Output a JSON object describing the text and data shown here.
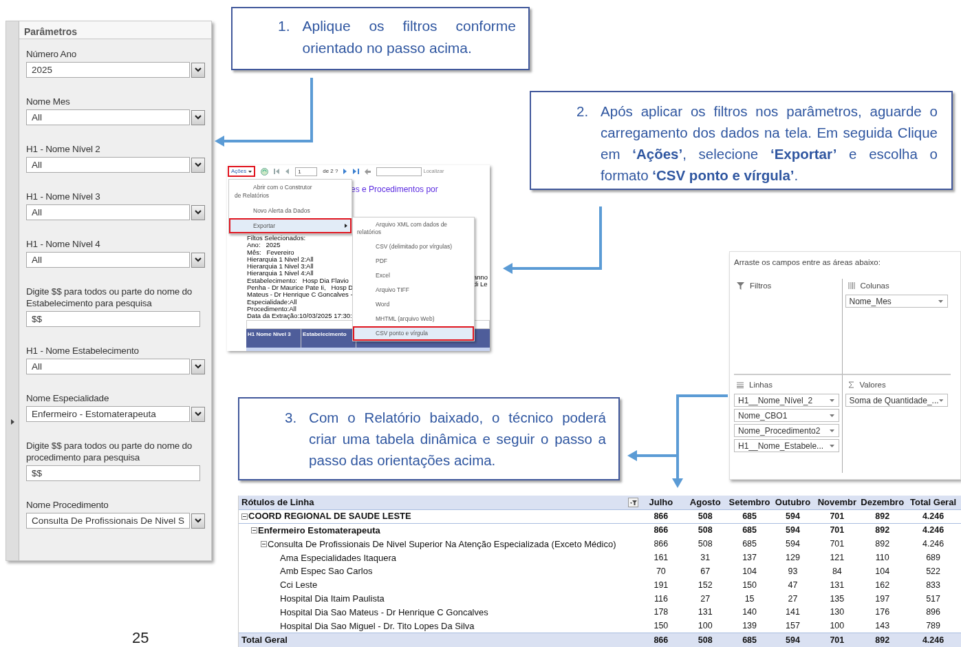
{
  "parameters_panel": {
    "title": "Parâmetros",
    "fields": [
      {
        "kind": "select",
        "label": "Número Ano",
        "value": "2025"
      },
      {
        "kind": "select",
        "label": "Nome Mes",
        "value": "All"
      },
      {
        "kind": "select",
        "label": "H1 - Nome Nível 2",
        "value": "All"
      },
      {
        "kind": "select",
        "label": "H1 - Nome Nível 3",
        "value": "All"
      },
      {
        "kind": "select",
        "label": "H1 - Nome Nível 4",
        "value": "All"
      },
      {
        "kind": "text",
        "label": "Digite $$ para todos ou parte do nome do Estabelecimento para pesquisa",
        "value": "$$"
      },
      {
        "kind": "select",
        "label": "H1 - Nome Estabelecimento",
        "value": "All"
      },
      {
        "kind": "select",
        "label": "Nome Especialidade",
        "value": "Enfermeiro - Estomaterapeuta"
      },
      {
        "kind": "text",
        "label": "Digite $$ para todos ou parte do nome do procedimento para pesquisa",
        "value": "$$"
      },
      {
        "kind": "select",
        "label": "Nome Procedimento",
        "value": "Consulta De Profissionais De Nivel S"
      }
    ]
  },
  "callouts": [
    {
      "number": "1.",
      "text": "Aplique os filtros conforme orientado no passo acima."
    },
    {
      "number": "2.",
      "text": "Após aplicar os filtros nos parâmetros, aguarde o carregamento dos dados na tela. Em seguida Clique em **‘Ações’**, selecione **‘Exportar’** e escolha o formato **‘CSV ponto e vírgula’**."
    },
    {
      "number": "3.",
      "text": "Com o Relatório baixado, o técnico poderá criar uma tabela dinâmica e seguir o passo a passo das orientações acima."
    }
  ],
  "report_viewer": {
    "actions": {
      "label": "Ações",
      "highlighted": true
    },
    "page": "1",
    "page_count": "de 2 ?",
    "find_label": "Localizar",
    "title_fragment": "es e Procedimentos por",
    "menu": [
      {
        "kind": "item",
        "label": "Abrir com o Construtor de Relatórios",
        "highlighted": false
      },
      {
        "kind": "item",
        "label": "Novo Alerta da Dados",
        "highlighted": false
      },
      {
        "kind": "submenu",
        "label": "Exportar",
        "highlighted": true
      }
    ],
    "export_menu": [
      {
        "label": "Arquivo XML com dados de relatórios",
        "highlighted": false
      },
      {
        "label": "CSV (delimitado por vírgulas)",
        "highlighted": false
      },
      {
        "label": "PDF",
        "highlighted": false
      },
      {
        "label": "Excel",
        "highlighted": false
      },
      {
        "label": "Arquivo TIFF",
        "highlighted": false
      },
      {
        "label": "Word",
        "highlighted": false
      },
      {
        "label": "MHTML (arquivo Web)",
        "highlighted": false
      },
      {
        "label": "CSV ponto e vírgula",
        "highlighted": true
      }
    ],
    "report_lines": [
      "Filtos Selecionados:",
      "Ano:   2025",
      "Mês:   Fevereiro",
      "Hierarquia 1 Nivel 2:All",
      "Hierarquia 1 Nivel 3:All",
      "Hierarquia 1 Nivel 4:All",
      "Estabelecimento:   Hosp Dia Flavio",
      "Penha - Dr Maurice Pate Ii,   Hosp D",
      "Mateus - Dr Henrique C Goncalves -",
      "Especialidade:All",
      "Procedimento:All",
      "Data da Extração:10/03/2025 17:30:"
    ],
    "report_fragments": [
      "anno",
      "di Le"
    ],
    "table_headers": [
      "H1 Nome Nível 3",
      "Estabelecimento"
    ]
  },
  "field_list": {
    "instruction": "Arraste os campos entre as áreas abaixo:",
    "areas": [
      {
        "kind": "filters",
        "label": "Filtros"
      },
      {
        "kind": "columns",
        "label": "Colunas",
        "fields": [
          "Nome_Mes"
        ]
      },
      {
        "kind": "rows",
        "label": "Linhas",
        "fields": [
          "H1__Nome_Nível_2",
          "Nome_CBO1",
          "Nome_Procedimento2",
          "H1__Nome_Estabele..."
        ]
      },
      {
        "kind": "values",
        "label": "Valores",
        "fields": [
          "Soma de Quantidade_..."
        ]
      }
    ]
  },
  "pivot_table": {
    "row_header": "Rótulos de Linha",
    "columns": [
      "Julho",
      "Agosto",
      "Setembro",
      "Outubro",
      "Novembr",
      "Dezembro",
      "Total Geral"
    ],
    "rows": [
      {
        "label": "COORD REGIONAL DE SAUDE LESTE",
        "bold": true,
        "expanded": true,
        "values": [
          "866",
          "508",
          "685",
          "594",
          "701",
          "892",
          "4.246"
        ],
        "children": [
          {
            "label": "Enfermeiro Estomaterapeuta",
            "bold": true,
            "expanded": true,
            "values": [
              "866",
              "508",
              "685",
              "594",
              "701",
              "892",
              "4.246"
            ],
            "children": [
              {
                "label": "Consulta De Profissionais De Nivel Superior Na Atenção Especializada (Exceto Médico)",
                "bold": false,
                "expanded": true,
                "values": [
                  "866",
                  "508",
                  "685",
                  "594",
                  "701",
                  "892",
                  "4.246"
                ],
                "children": [
                  {
                    "label": "Ama Especialidades Itaquera",
                    "bold": false,
                    "values": [
                      "161",
                      "31",
                      "137",
                      "129",
                      "121",
                      "110",
                      "689"
                    ]
                  },
                  {
                    "label": "Amb Espec Sao Carlos",
                    "bold": false,
                    "values": [
                      "70",
                      "67",
                      "104",
                      "93",
                      "84",
                      "104",
                      "522"
                    ]
                  },
                  {
                    "label": "Cci Leste",
                    "bold": false,
                    "values": [
                      "191",
                      "152",
                      "150",
                      "47",
                      "131",
                      "162",
                      "833"
                    ]
                  },
                  {
                    "label": "Hospital Dia Itaim Paulista",
                    "bold": false,
                    "values": [
                      "116",
                      "27",
                      "15",
                      "27",
                      "135",
                      "197",
                      "517"
                    ]
                  },
                  {
                    "label": "Hospital Dia Sao Mateus - Dr Henrique C Goncalves",
                    "bold": false,
                    "values": [
                      "178",
                      "131",
                      "140",
                      "141",
                      "130",
                      "176",
                      "896"
                    ]
                  },
                  {
                    "label": "Hospital Dia Sao Miguel - Dr. Tito Lopes Da Silva",
                    "bold": false,
                    "values": [
                      "150",
                      "100",
                      "139",
                      "157",
                      "100",
                      "143",
                      "789"
                    ]
                  }
                ]
              }
            ]
          }
        ]
      }
    ],
    "total": {
      "label": "Total Geral",
      "values": [
        "866",
        "508",
        "685",
        "594",
        "701",
        "892",
        "4.246"
      ]
    }
  },
  "page_number": "25"
}
